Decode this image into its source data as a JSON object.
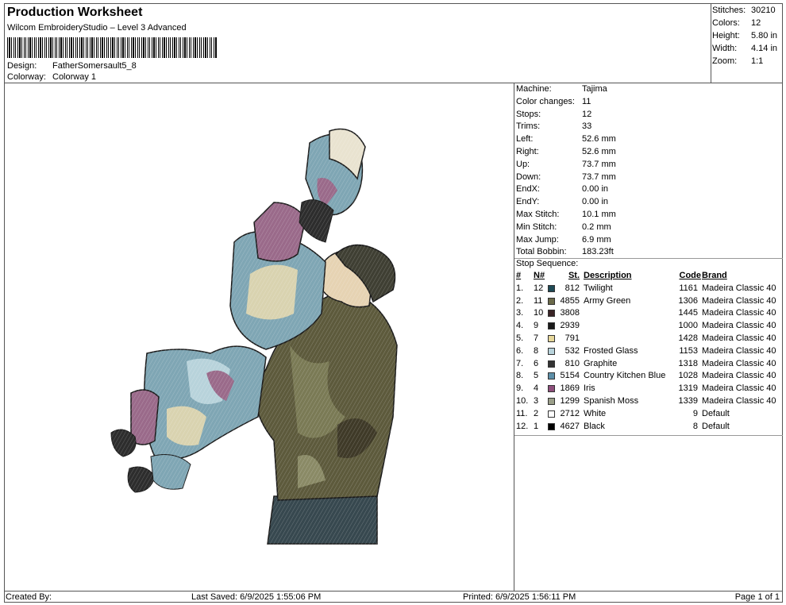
{
  "header": {
    "title": "Production Worksheet",
    "subtitle": "Wilcom EmbroideryStudio – Level 3 Advanced",
    "design_label": "Design:",
    "design_value": "FatherSomersault5_8",
    "colorway_label": "Colorway:",
    "colorway_value": "Colorway 1"
  },
  "stats": [
    {
      "k": "Stitches:",
      "v": "30210"
    },
    {
      "k": "Colors:",
      "v": "12"
    },
    {
      "k": "Height:",
      "v": "5.80 in"
    },
    {
      "k": "Width:",
      "v": "4.14 in"
    },
    {
      "k": "Zoom:",
      "v": "1:1"
    }
  ],
  "machine_info": [
    {
      "k": "Machine:",
      "v": "Tajima"
    },
    {
      "k": "Color changes:",
      "v": "11"
    },
    {
      "k": "Stops:",
      "v": "12"
    },
    {
      "k": "Trims:",
      "v": "33"
    },
    {
      "k": "Left:",
      "v": "52.6 mm"
    },
    {
      "k": "Right:",
      "v": "52.6 mm"
    },
    {
      "k": "Up:",
      "v": "73.7 mm"
    },
    {
      "k": "Down:",
      "v": "73.7 mm"
    },
    {
      "k": "EndX:",
      "v": "0.00 in"
    },
    {
      "k": "EndY:",
      "v": "0.00 in"
    },
    {
      "k": "Max Stitch:",
      "v": "10.1 mm"
    },
    {
      "k": "Min Stitch:",
      "v": "0.2 mm"
    },
    {
      "k": "Max Jump:",
      "v": "6.9 mm"
    },
    {
      "k": "Total Bobbin:",
      "v": "183.23ft"
    }
  ],
  "stop_sequence": {
    "title": "Stop Sequence:",
    "columns": {
      "idx": "#",
      "n": "N#",
      "st": "St.",
      "desc": "Description",
      "code": "Code",
      "brand": "Brand"
    },
    "rows": [
      {
        "idx": "1.",
        "n": "12",
        "st": "812",
        "color": "#1f4a55",
        "desc": "Twilight",
        "code": "1161",
        "brand": "Madeira Classic 40"
      },
      {
        "idx": "2.",
        "n": "11",
        "st": "4855",
        "color": "#6b6a4a",
        "desc": "Army Green",
        "code": "1306",
        "brand": "Madeira Classic 40"
      },
      {
        "idx": "3.",
        "n": "10",
        "st": "3808",
        "color": "#3a2426",
        "desc": "",
        "code": "1445",
        "brand": "Madeira Classic 40"
      },
      {
        "idx": "4.",
        "n": "9",
        "st": "2939",
        "color": "#1a1a1a",
        "desc": "",
        "code": "1000",
        "brand": "Madeira Classic 40"
      },
      {
        "idx": "5.",
        "n": "7",
        "st": "791",
        "color": "#e6d79a",
        "desc": "",
        "code": "1428",
        "brand": "Madeira Classic 40"
      },
      {
        "idx": "6.",
        "n": "8",
        "st": "532",
        "color": "#b8d3db",
        "desc": "Frosted Glass",
        "code": "1153",
        "brand": "Madeira Classic 40"
      },
      {
        "idx": "7.",
        "n": "6",
        "st": "810",
        "color": "#333333",
        "desc": "Graphite",
        "code": "1318",
        "brand": "Madeira Classic 40"
      },
      {
        "idx": "8.",
        "n": "5",
        "st": "5154",
        "color": "#5d8fa8",
        "desc": "Country Kitchen Blue",
        "code": "1028",
        "brand": "Madeira Classic 40"
      },
      {
        "idx": "9.",
        "n": "4",
        "st": "1869",
        "color": "#8e4f7c",
        "desc": "Iris",
        "code": "1319",
        "brand": "Madeira Classic 40"
      },
      {
        "idx": "10.",
        "n": "3",
        "st": "1299",
        "color": "#9b9f8a",
        "desc": "Spanish Moss",
        "code": "1339",
        "brand": "Madeira Classic 40"
      },
      {
        "idx": "11.",
        "n": "2",
        "st": "2712",
        "color": "#ffffff",
        "desc": "White",
        "code": "9",
        "brand": "Default"
      },
      {
        "idx": "12.",
        "n": "1",
        "st": "4627",
        "color": "#000000",
        "desc": "Black",
        "code": "8",
        "brand": "Default"
      }
    ]
  },
  "footer": {
    "created_by": "Created By:",
    "last_saved": "Last Saved: 6/9/2025 1:55:06 PM",
    "printed": "Printed: 6/9/2025 1:56:11 PM",
    "page": "Page 1 of 1"
  }
}
